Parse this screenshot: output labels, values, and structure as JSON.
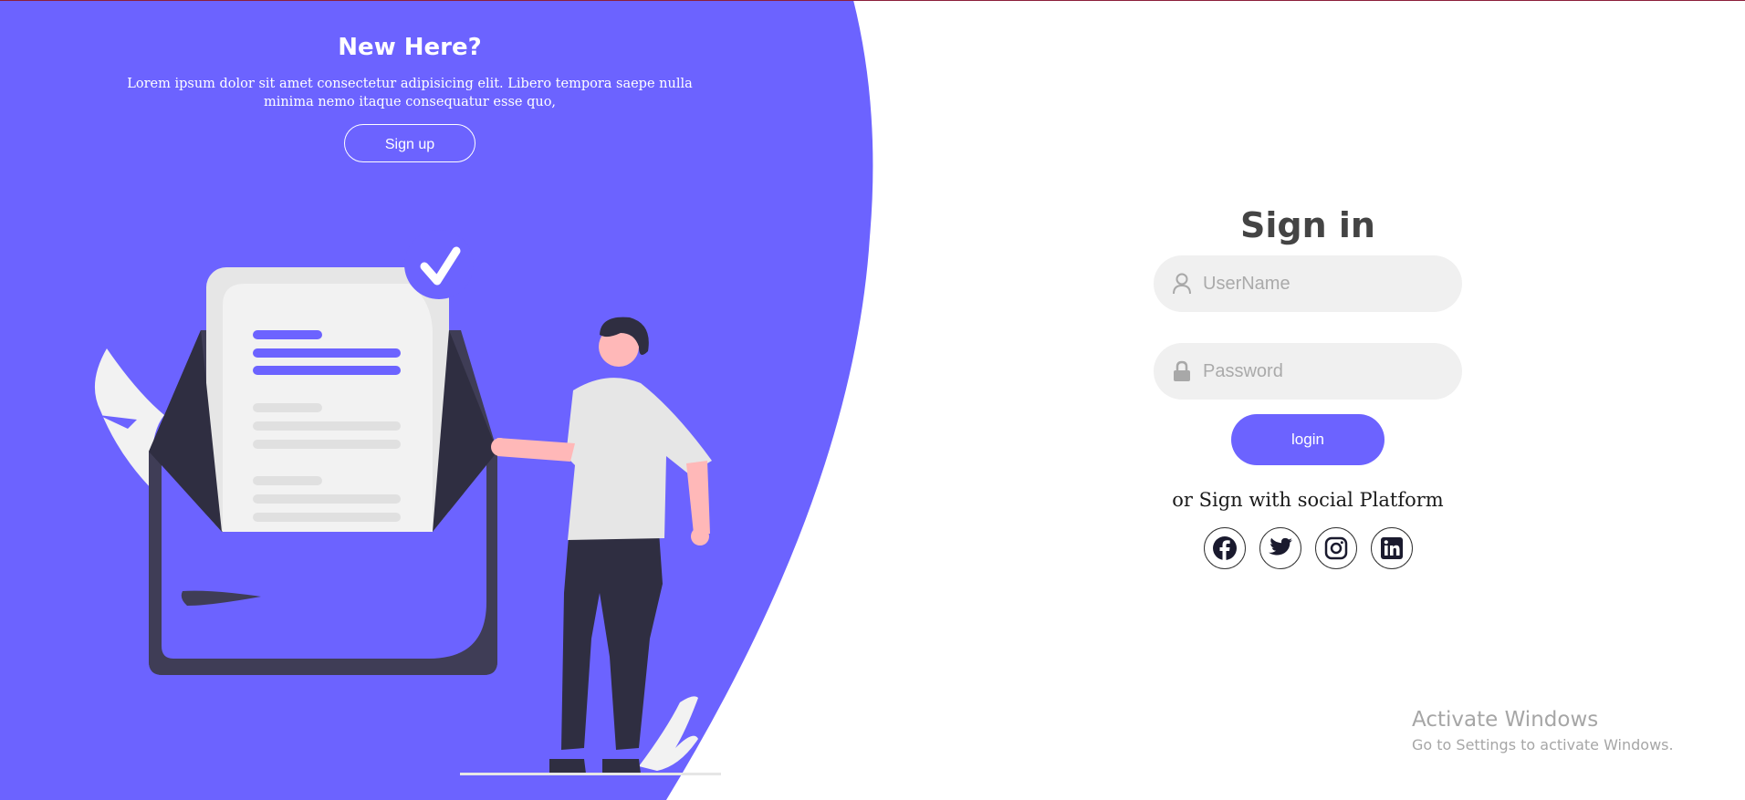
{
  "colors": {
    "accent": "#6c63ff",
    "panel_dark": "#3f3d56",
    "page_light": "#ffffff",
    "field_bg": "#f0f0f0",
    "skin": "#ffb8b8",
    "text_dark": "#444444"
  },
  "left_panel": {
    "title": "New Here?",
    "text": "Lorem ipsum dolor sit amet consectetur adipisicing elit. Libero tempora saepe nulla minima nemo itaque consequatur esse quo,",
    "signup_label": "Sign up",
    "illustration_icon": "document-folder-person-illustration"
  },
  "signin": {
    "title": "Sign in",
    "username": {
      "placeholder": "UserName",
      "value": "",
      "icon": "user-icon"
    },
    "password": {
      "placeholder": "Password",
      "value": "",
      "icon": "lock-icon"
    },
    "login_label": "login",
    "social_text": "or Sign with social Platform",
    "social": [
      {
        "name": "facebook",
        "icon": "facebook-icon"
      },
      {
        "name": "twitter",
        "icon": "twitter-icon"
      },
      {
        "name": "instagram",
        "icon": "instagram-icon"
      },
      {
        "name": "linkedin",
        "icon": "linkedin-icon"
      }
    ]
  },
  "watermark": {
    "title": "Activate Windows",
    "subtitle": "Go to Settings to activate Windows."
  }
}
